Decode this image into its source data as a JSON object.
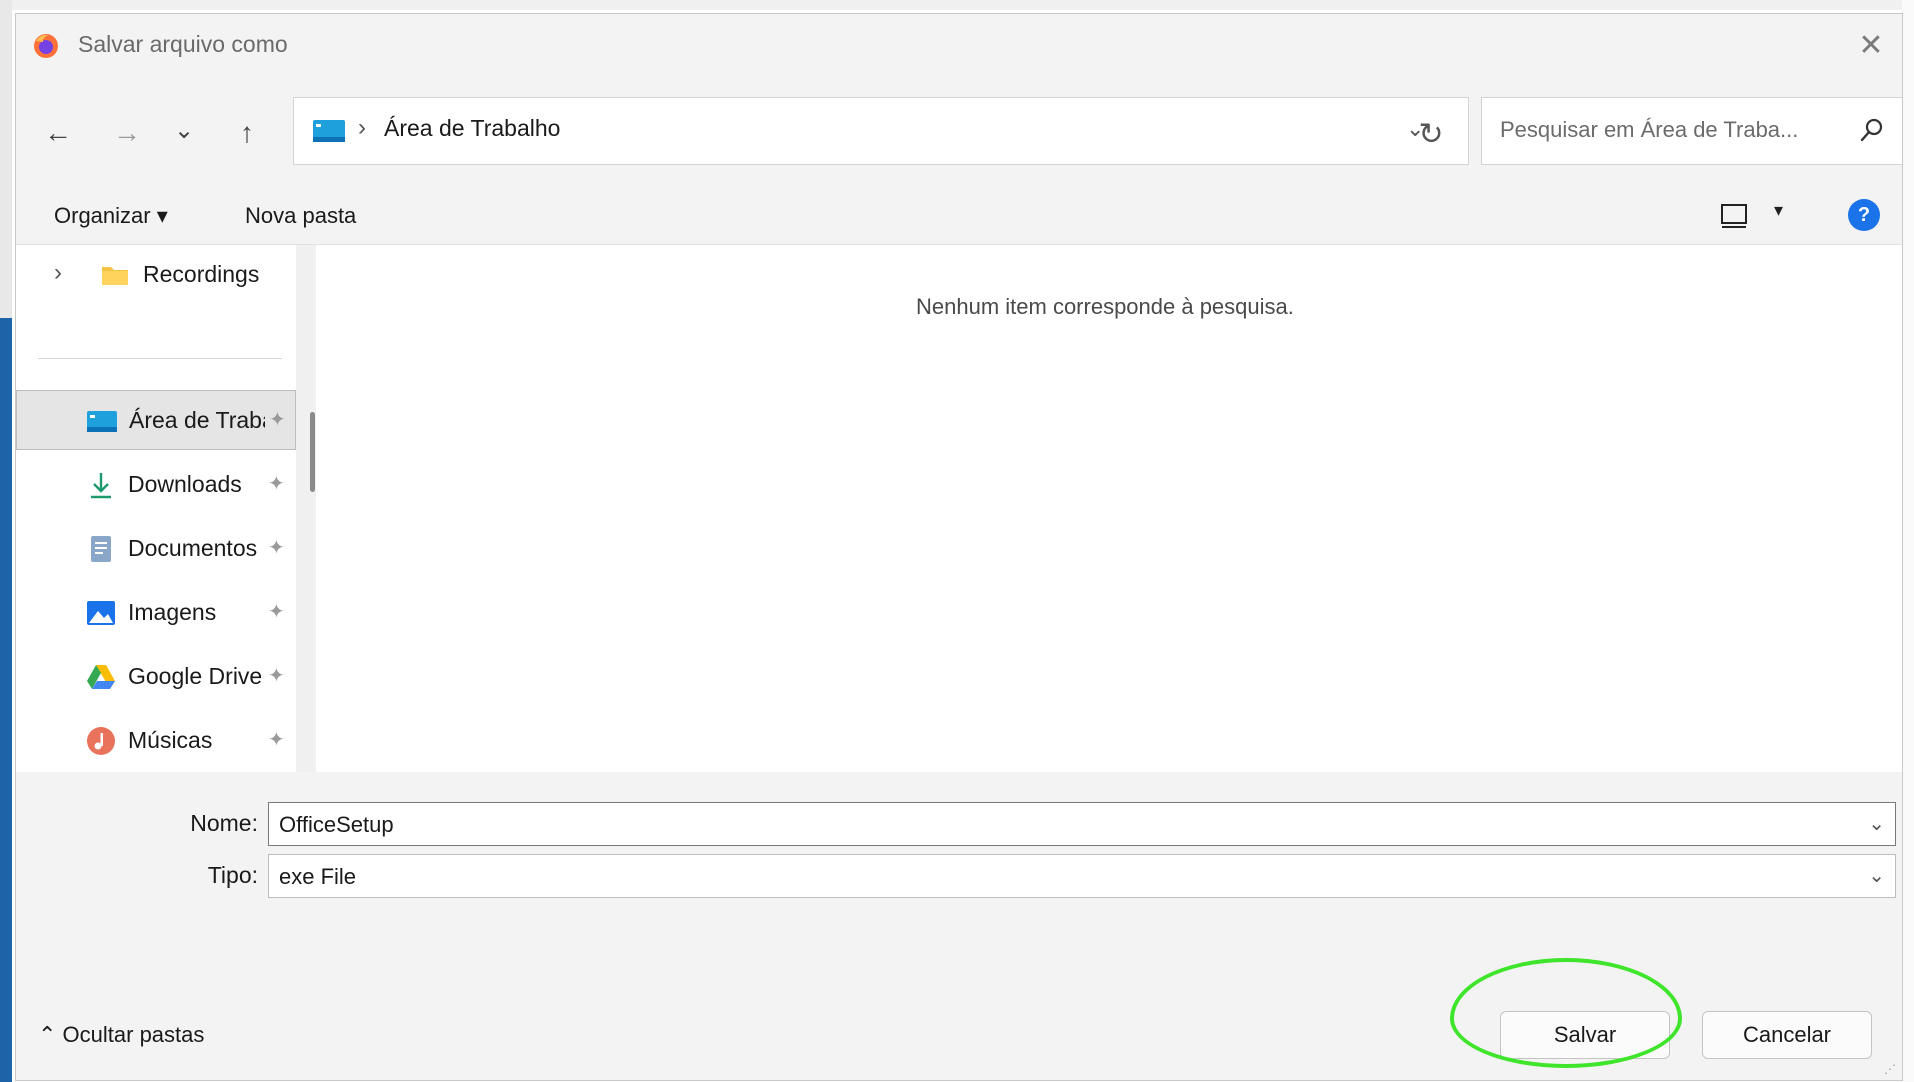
{
  "window": {
    "title": "Salvar arquivo como",
    "close_glyph": "✕"
  },
  "navigation": {
    "back_glyph": "←",
    "forward_glyph": "→",
    "recent_glyph": "⌄",
    "up_glyph": "↑",
    "address_path": "Área de Trabalho",
    "address_separator": "›",
    "address_dropdown_glyph": "⌄",
    "refresh_glyph": "↻"
  },
  "search": {
    "placeholder": "Pesquisar em Área de Traba..."
  },
  "toolbar": {
    "organize_label": "Organizar ▾",
    "new_folder_label": "Nova pasta",
    "view_caret": "▾",
    "help_glyph": "?"
  },
  "nav_pane": {
    "items": [
      {
        "label": "Recordings",
        "icon": "folder-icon",
        "pinned": false
      },
      {
        "label": "Área de Trabalho",
        "icon": "desktop-icon",
        "pinned": true,
        "selected": true
      },
      {
        "label": "Downloads",
        "icon": "download-icon",
        "pinned": true
      },
      {
        "label": "Documentos",
        "icon": "document-icon",
        "pinned": true
      },
      {
        "label": "Imagens",
        "icon": "pictures-icon",
        "pinned": true
      },
      {
        "label": "Google Drive",
        "icon": "google-drive-icon",
        "pinned": true
      },
      {
        "label": "Músicas",
        "icon": "music-icon",
        "pinned": true
      }
    ],
    "expander_glyph": "›",
    "pin_glyph": "📌"
  },
  "content": {
    "empty_message": "Nenhum item corresponde à pesquisa."
  },
  "form": {
    "name_label": "Nome:",
    "name_value": "OfficeSetup",
    "type_label": "Tipo:",
    "type_value": "exe File",
    "chevron_glyph": "⌄"
  },
  "footer": {
    "hide_folders_label": "⌃  Ocultar pastas",
    "save_label": "Salvar",
    "cancel_label": "Cancelar"
  },
  "colors": {
    "accent": "#1a73e8",
    "highlight": "#3ee52a",
    "dialog_bg": "#f3f3f3"
  }
}
